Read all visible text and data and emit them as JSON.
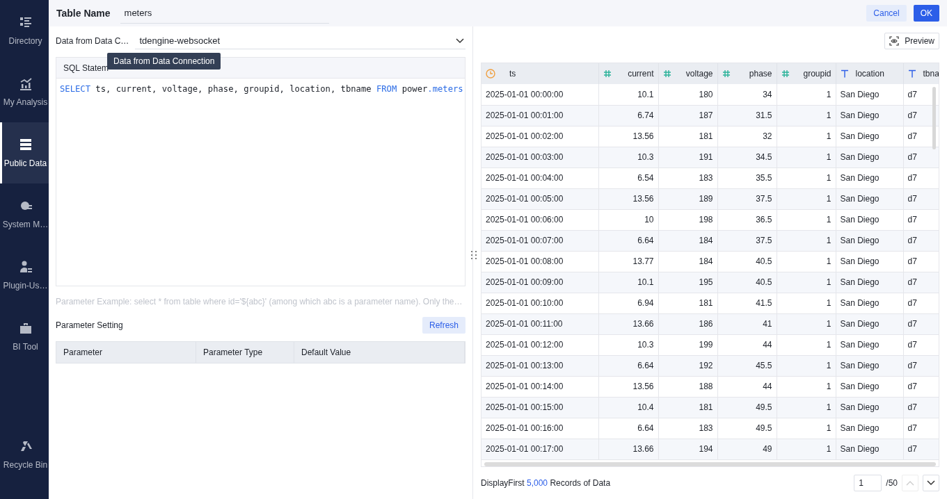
{
  "sidebar": {
    "items": [
      {
        "label": "Directory",
        "selected": false
      },
      {
        "label": "My Analysis",
        "selected": false
      },
      {
        "label": "Public Data",
        "selected": true
      },
      {
        "label": "System M…",
        "selected": false
      },
      {
        "label": "Plugin-Us…",
        "selected": false
      },
      {
        "label": "BI Tool",
        "selected": false
      }
    ],
    "bottom_item": {
      "label": "Recycle Bin",
      "selected": false
    }
  },
  "header": {
    "label": "Table Name",
    "value": "meters",
    "buttons": [
      {
        "label": "Cancel",
        "kind": "secondary"
      },
      {
        "label": "OK",
        "kind": "primary"
      }
    ]
  },
  "connection": {
    "label": "Data from Data C…",
    "value": "tdengine-websocket",
    "tooltip": "Data from Data Connection"
  },
  "sql": {
    "tab": "SQL Statem",
    "tokens": [
      {
        "text": "SELECT",
        "kind": "keyword"
      },
      {
        "text": " ts, current, voltage, phase, groupid, location, tbname ",
        "kind": "plain"
      },
      {
        "text": "FROM",
        "kind": "keyword"
      },
      {
        "text": " power",
        "kind": "plain"
      },
      {
        "text": ".meters",
        "kind": "keyword"
      }
    ]
  },
  "hint": "Parameter Example: select * from table where id='${abc}' (among which abc is a parameter name). Only the…",
  "parameters": {
    "title": "Parameter Setting",
    "refresh": "Refresh",
    "columns": [
      "Parameter",
      "Parameter Type",
      "Default Value"
    ]
  },
  "preview": {
    "button": "Preview"
  },
  "table": {
    "columns": [
      {
        "name": "ts",
        "kind": "time"
      },
      {
        "name": "current",
        "kind": "number"
      },
      {
        "name": "voltage",
        "kind": "number"
      },
      {
        "name": "phase",
        "kind": "number"
      },
      {
        "name": "groupid",
        "kind": "number"
      },
      {
        "name": "location",
        "kind": "text"
      },
      {
        "name": "tbna",
        "kind": "text"
      }
    ],
    "rows": [
      [
        "2025-01-01 00:00:00",
        "10.1",
        "180",
        "34",
        "1",
        "San Diego",
        "d7"
      ],
      [
        "2025-01-01 00:01:00",
        "6.74",
        "187",
        "31.5",
        "1",
        "San Diego",
        "d7"
      ],
      [
        "2025-01-01 00:02:00",
        "13.56",
        "181",
        "32",
        "1",
        "San Diego",
        "d7"
      ],
      [
        "2025-01-01 00:03:00",
        "10.3",
        "191",
        "34.5",
        "1",
        "San Diego",
        "d7"
      ],
      [
        "2025-01-01 00:04:00",
        "6.54",
        "183",
        "35.5",
        "1",
        "San Diego",
        "d7"
      ],
      [
        "2025-01-01 00:05:00",
        "13.56",
        "189",
        "37.5",
        "1",
        "San Diego",
        "d7"
      ],
      [
        "2025-01-01 00:06:00",
        "10",
        "198",
        "36.5",
        "1",
        "San Diego",
        "d7"
      ],
      [
        "2025-01-01 00:07:00",
        "6.64",
        "184",
        "37.5",
        "1",
        "San Diego",
        "d7"
      ],
      [
        "2025-01-01 00:08:00",
        "13.77",
        "184",
        "40.5",
        "1",
        "San Diego",
        "d7"
      ],
      [
        "2025-01-01 00:09:00",
        "10.1",
        "195",
        "40.5",
        "1",
        "San Diego",
        "d7"
      ],
      [
        "2025-01-01 00:10:00",
        "6.94",
        "181",
        "41.5",
        "1",
        "San Diego",
        "d7"
      ],
      [
        "2025-01-01 00:11:00",
        "13.66",
        "186",
        "41",
        "1",
        "San Diego",
        "d7"
      ],
      [
        "2025-01-01 00:12:00",
        "10.3",
        "199",
        "44",
        "1",
        "San Diego",
        "d7"
      ],
      [
        "2025-01-01 00:13:00",
        "6.64",
        "192",
        "45.5",
        "1",
        "San Diego",
        "d7"
      ],
      [
        "2025-01-01 00:14:00",
        "13.56",
        "188",
        "44",
        "1",
        "San Diego",
        "d7"
      ],
      [
        "2025-01-01 00:15:00",
        "10.4",
        "181",
        "49.5",
        "1",
        "San Diego",
        "d7"
      ],
      [
        "2025-01-01 00:16:00",
        "6.64",
        "183",
        "49.5",
        "1",
        "San Diego",
        "d7"
      ],
      [
        "2025-01-01 00:17:00",
        "13.66",
        "194",
        "49",
        "1",
        "San Diego",
        "d7"
      ]
    ]
  },
  "footer": {
    "prefix": "DisplayFirst",
    "count": "5,000",
    "suffix": "Records of Data",
    "page": "1",
    "total": "/50"
  }
}
